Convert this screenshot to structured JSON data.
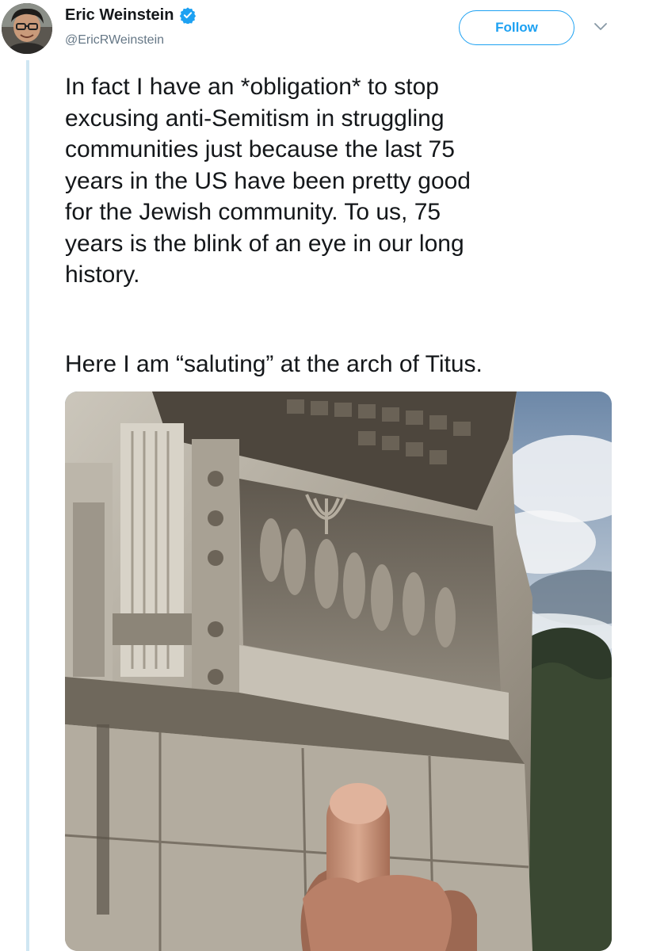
{
  "tweet": {
    "author": {
      "display_name": "Eric Weinstein",
      "handle": "@EricRWeinstein",
      "verified": true,
      "avatar_icon": "avatar-photo"
    },
    "follow_label": "Follow",
    "menu_icon": "chevron-down-icon",
    "text_paragraph_1": "In fact I have an *obligation* to stop\nexcusing anti-Semitism in struggling\ncommunities just because the last 75\nyears in the US have been pretty good\nfor the Jewish community. To us, 75\nyears is the blink of an eye in our long\nhistory.",
    "text_paragraph_2": "Here I am “saluting” at the arch of Titus.",
    "media": {
      "type": "photo"
    }
  },
  "colors": {
    "accent": "#1da1f2",
    "text": "#14171a",
    "secondary_text": "#657786",
    "thread_line": "#cfe6f2"
  }
}
